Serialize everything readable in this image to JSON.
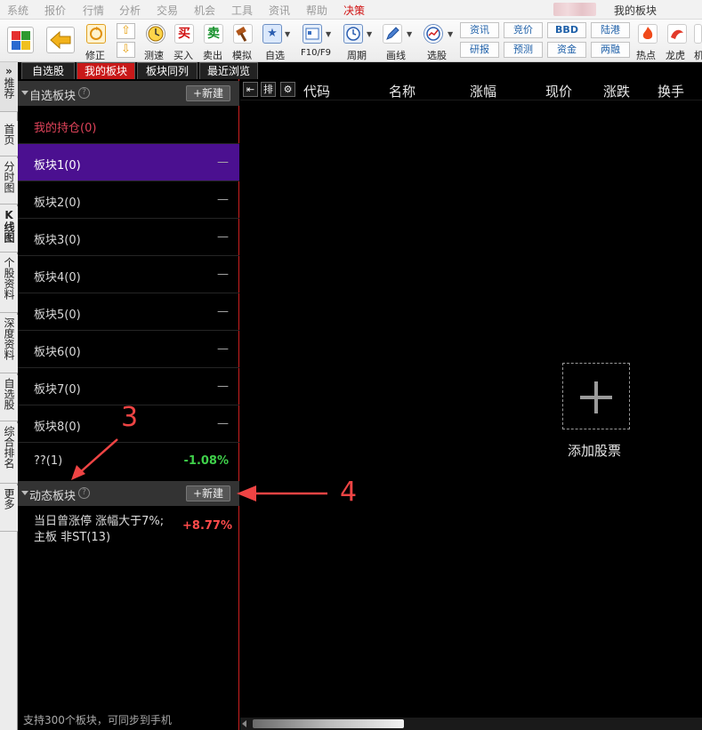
{
  "menubar": {
    "items": [
      "系统",
      "报价",
      "行情",
      "分析",
      "交易",
      "机会",
      "工具",
      "资讯",
      "帮助",
      "决策"
    ],
    "active_index": 9,
    "window_title": "我的板块"
  },
  "toolbar": {
    "buttons": [
      "修正",
      "测速",
      "买入",
      "卖出",
      "模拟",
      "自选",
      "F10/F9",
      "周期",
      "画线",
      "选股",
      "热点",
      "龙虎",
      "机"
    ],
    "small": {
      "zixun": "资讯",
      "yanbao": "研报",
      "jingjia": "竞价",
      "yuce": "预测",
      "bbd": "BBD",
      "zijin": "资金",
      "lugang": "陆港",
      "liangrong": "两融"
    },
    "icon_glyphs": {
      "buy": "买",
      "sell": "卖"
    }
  },
  "top_tabs": [
    "自选股",
    "我的板块",
    "板块同列",
    "最近浏览"
  ],
  "active_top_tab": 1,
  "side_tabs": [
    "推荐",
    "首页",
    "分时图",
    "K线图",
    "个股资料",
    "深度资料",
    "自选股",
    "综合排名",
    "更多"
  ],
  "side_tabs_top_marker": "»",
  "left_panel": {
    "custom_section": {
      "title": "自选板块",
      "new_label": "+新建",
      "help": "?"
    },
    "rows": [
      {
        "name": "我的持仓(0)",
        "value": ""
      },
      {
        "name": "板块1(0)",
        "value": "—"
      },
      {
        "name": "板块2(0)",
        "value": "—"
      },
      {
        "name": "板块3(0)",
        "value": "—"
      },
      {
        "name": "板块4(0)",
        "value": "—"
      },
      {
        "name": "板块5(0)",
        "value": "—"
      },
      {
        "name": "板块6(0)",
        "value": "—"
      },
      {
        "name": "板块7(0)",
        "value": "—"
      },
      {
        "name": "板块8(0)",
        "value": "—"
      },
      {
        "name": "??(1)",
        "value": "-1.08%"
      }
    ],
    "dynamic_section": {
      "title": "动态板块",
      "new_label": "+新建",
      "help": "?"
    },
    "dynamic_item": {
      "line1": "当日曾涨停 涨幅大于7%;",
      "line2": "主板 非ST(13)",
      "value": "+8.77%"
    },
    "footnote": "支持300个板块，可同步到手机"
  },
  "right_panel": {
    "header_buttons": [
      "⇤",
      "排",
      "⚙"
    ],
    "columns": [
      "代码",
      "名称",
      "涨幅",
      "现价",
      "涨跌",
      "换手"
    ],
    "add_stock_label": "添加股票"
  },
  "annotations": {
    "arrow3_label": "3",
    "arrow4_label": "4"
  },
  "colors": {
    "accent_red": "#c81818",
    "highlight_purple": "#4b1090",
    "up_red": "#ff4b4b",
    "down_green": "#3fd04a",
    "annotation": "#ee4444"
  }
}
